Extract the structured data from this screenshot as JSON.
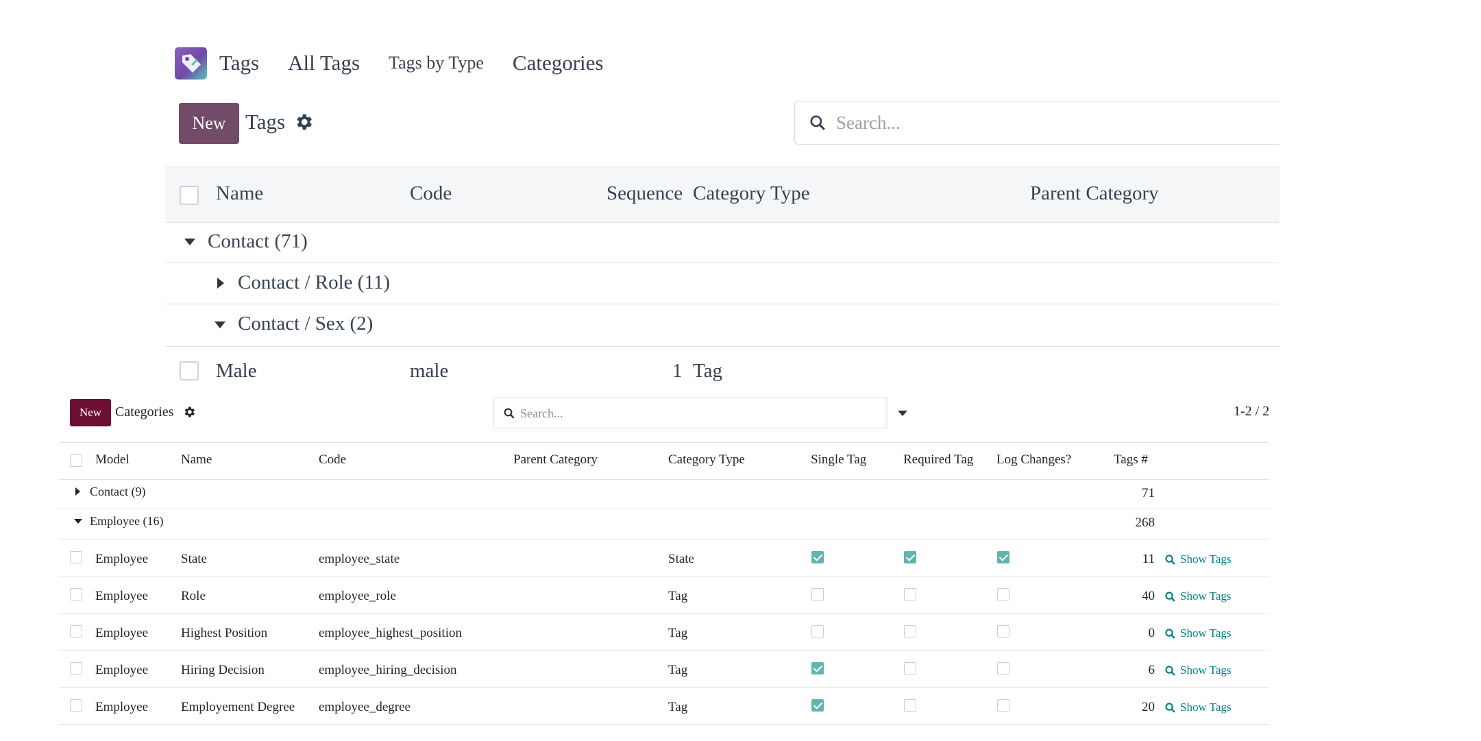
{
  "tags_view": {
    "nav": {
      "app_name": "Tags",
      "links": [
        "All Tags",
        "Tags by Type",
        "Categories"
      ]
    },
    "control": {
      "new_label": "New",
      "breadcrumb": "Tags",
      "search_placeholder": "Search..."
    },
    "columns": [
      "Name",
      "Code",
      "Sequence",
      "Category Type",
      "Parent Category"
    ],
    "groups": [
      {
        "label": "Contact (71)",
        "expanded": true
      },
      {
        "label": "Contact / Role (11)",
        "expanded": false
      },
      {
        "label": "Contact / Sex (2)",
        "expanded": true
      }
    ],
    "row": {
      "name": "Male",
      "code": "male",
      "sequence": "1",
      "category_type": "Tag"
    }
  },
  "categories_view": {
    "control": {
      "new_label": "New",
      "breadcrumb": "Categories",
      "search_placeholder": "Search...",
      "pager": "1-2 / 2"
    },
    "columns": [
      "Model",
      "Name",
      "Code",
      "Parent Category",
      "Category Type",
      "Single Tag",
      "Required Tag",
      "Log Changes?",
      "Tags #"
    ],
    "groups": [
      {
        "label": "Contact (9)",
        "count": "71",
        "expanded": false
      },
      {
        "label": "Employee (16)",
        "count": "268",
        "expanded": true
      }
    ],
    "show_tags_label": "Show Tags",
    "rows": [
      {
        "model": "Employee",
        "name": "State",
        "code": "employee_state",
        "parent": "",
        "type": "State",
        "single": true,
        "required": true,
        "log": true,
        "tags": "11"
      },
      {
        "model": "Employee",
        "name": "Role",
        "code": "employee_role",
        "parent": "",
        "type": "Tag",
        "single": false,
        "required": false,
        "log": false,
        "tags": "40"
      },
      {
        "model": "Employee",
        "name": "Highest Position",
        "code": "employee_highest_position",
        "parent": "",
        "type": "Tag",
        "single": false,
        "required": false,
        "log": false,
        "tags": "0"
      },
      {
        "model": "Employee",
        "name": "Hiring Decision",
        "code": "employee_hiring_decision",
        "parent": "",
        "type": "Tag",
        "single": true,
        "required": false,
        "log": false,
        "tags": "6"
      },
      {
        "model": "Employee",
        "name": "Employement Degree",
        "code": "employee_degree",
        "parent": "",
        "type": "Tag",
        "single": true,
        "required": false,
        "log": false,
        "tags": "20"
      }
    ]
  },
  "colors": {
    "brand_new_upper": "#714b67",
    "brand_new_lower": "#6b0f34",
    "checkbox_checked": "#62b5ad",
    "link_teal": "#017e84"
  },
  "icons": [
    "tag-app-logo-icon",
    "gear-icon",
    "search-icon",
    "caret-down-icon",
    "caret-right-icon",
    "magnifier-icon"
  ]
}
